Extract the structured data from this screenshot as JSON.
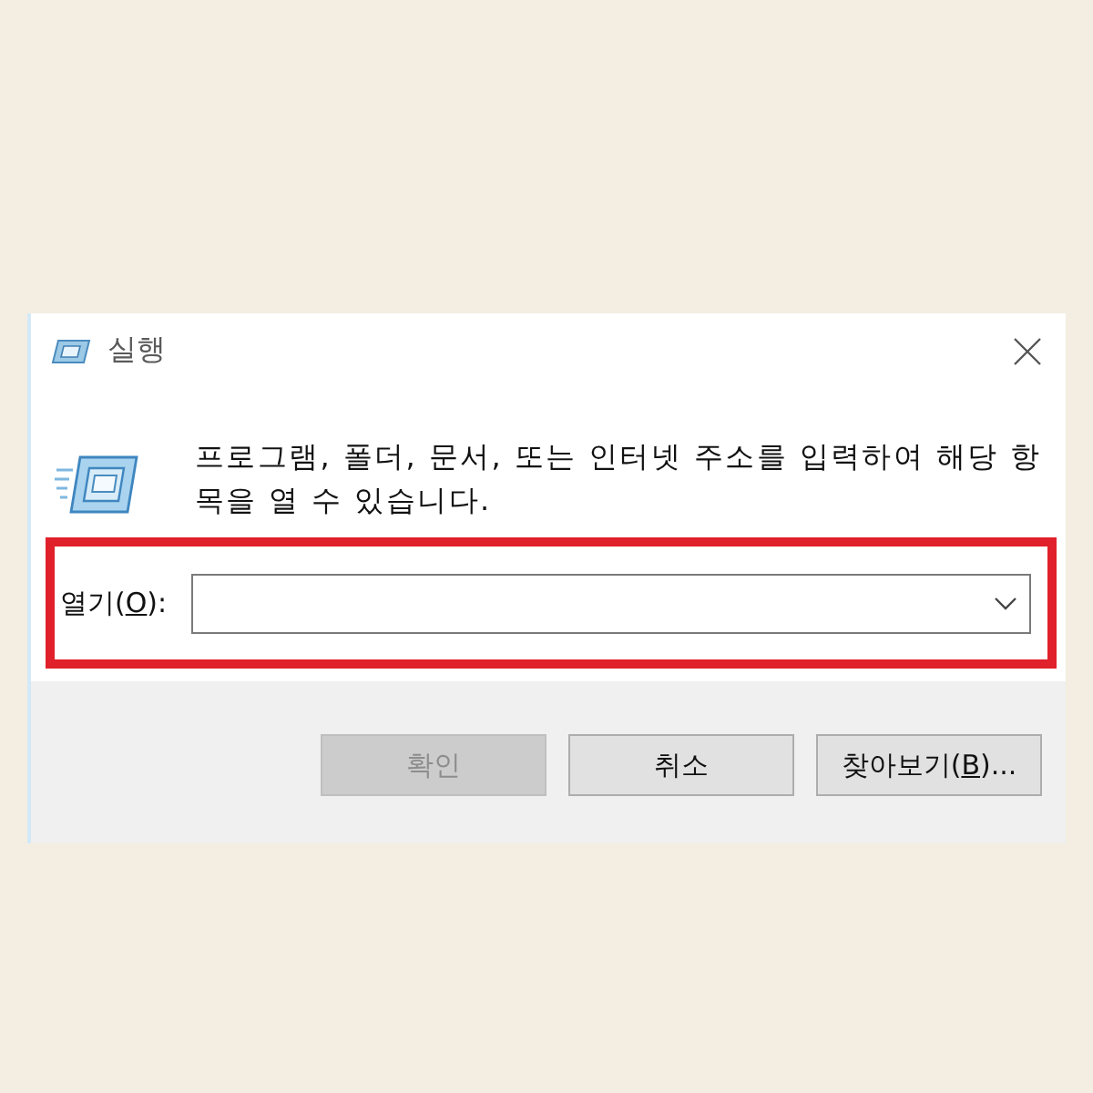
{
  "window": {
    "title": "실행"
  },
  "prompt": {
    "text": "프로그램, 폴더, 문서, 또는 인터넷 주소를 입력하여 해당 항목을 열 수 있습니다."
  },
  "open_field": {
    "label": "열기(",
    "access_key": "O",
    "label_after": "):"
  },
  "buttons": [
    {
      "label": "확인",
      "disabled": true
    },
    {
      "label": "취소",
      "disabled": false
    },
    {
      "label": "찾아보기(",
      "access_key": "B",
      "label_after": ")...",
      "disabled": false
    }
  ]
}
